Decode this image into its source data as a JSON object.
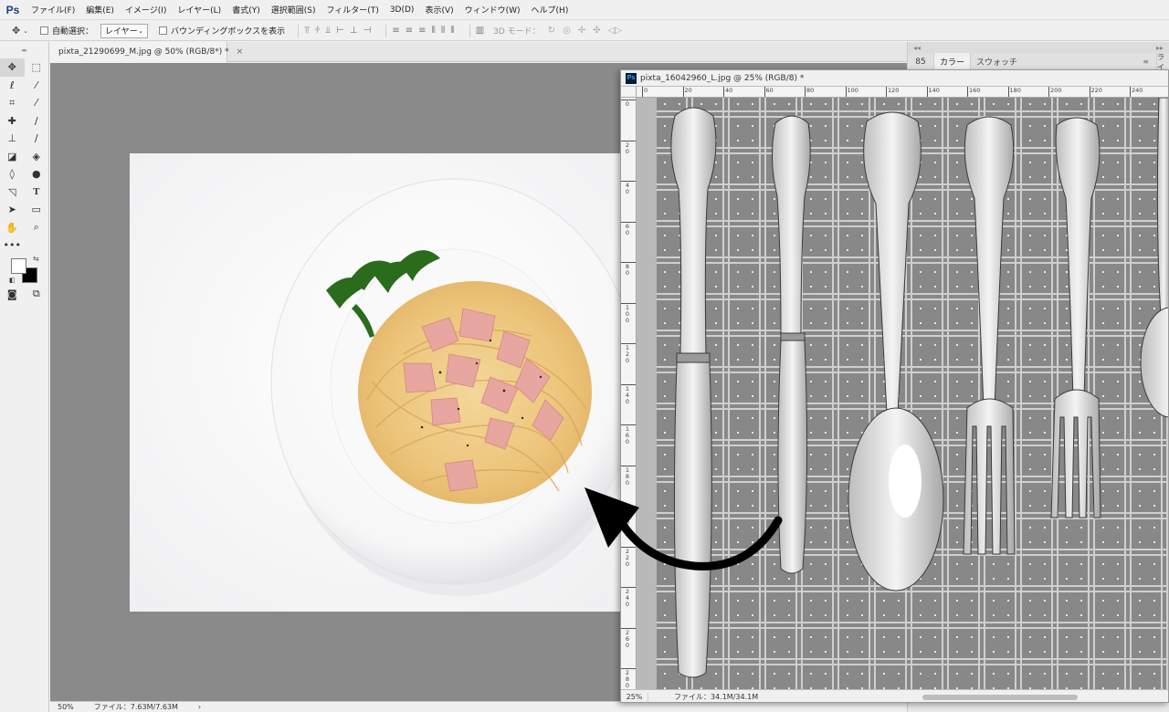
{
  "app": {
    "logo": "Ps"
  },
  "menu": [
    "ファイル(F)",
    "編集(E)",
    "イメージ(I)",
    "レイヤー(L)",
    "書式(Y)",
    "選択範囲(S)",
    "フィルター(T)",
    "3D(D)",
    "表示(V)",
    "ウィンドウ(W)",
    "ヘルプ(H)"
  ],
  "options": {
    "auto_select_label": "自動選択：",
    "auto_select_value": "レイヤー",
    "bounding_box_label": "バウンディングボックスを表示",
    "mode_3d_label": "3D モード："
  },
  "doc_tab": {
    "title": "pixta_21290699_M.jpg @ 50% (RGB/8*) *",
    "close": "×"
  },
  "status_left": {
    "zoom": "50%",
    "file": "ファイル：7.63M/7.63M",
    "arrow": "›"
  },
  "float_window": {
    "title": "pixta_16042960_L.jpg @ 25% (RGB/8) *",
    "zoom": "25%",
    "file": "ファイル：34.1M/34.1M",
    "hruler": [
      "0",
      "20",
      "40",
      "60",
      "80",
      "100",
      "120",
      "140",
      "160",
      "180",
      "200",
      "220",
      "240"
    ],
    "vruler": [
      "0",
      "2 0",
      "4 0",
      "6 0",
      "8 0",
      "1 0 0",
      "1 2 0",
      "1 4 0",
      "1 6 0",
      "1 8 0",
      "2 0 0",
      "2 2 0",
      "2 4 0",
      "2 6 0",
      "2 8 0"
    ]
  },
  "right_panel": {
    "number": "85",
    "tabs": [
      "カラー",
      "スウォッチ"
    ],
    "side_tab": "ライ"
  },
  "colors": {
    "foreground": "#ffffff",
    "background": "#000000",
    "canvas_bg": "#8a8a8a"
  }
}
